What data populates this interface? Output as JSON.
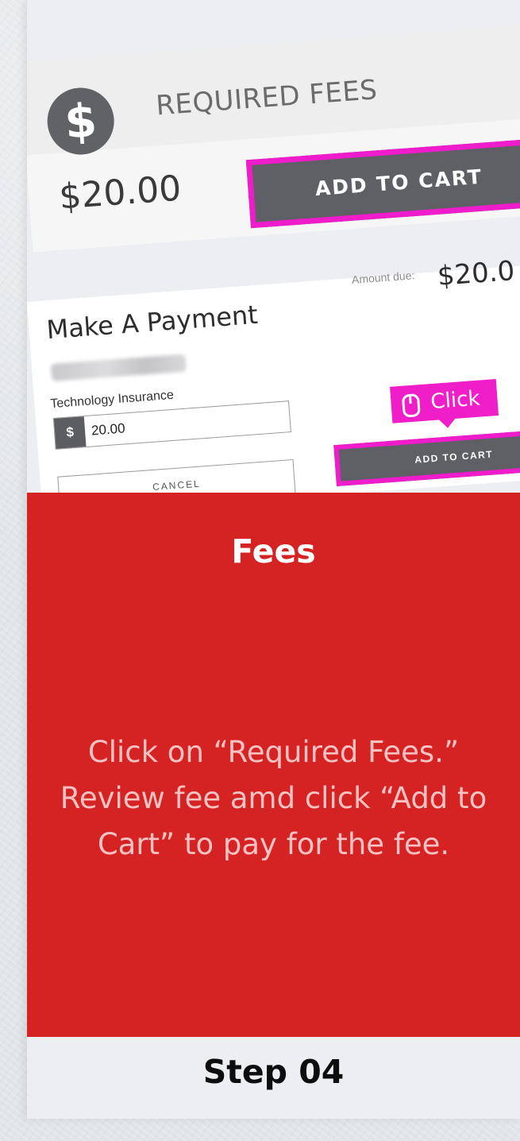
{
  "fees_screen": {
    "title": "REQUIRED FEES",
    "price": "$20.00",
    "add_to_cart": "ADD TO CART",
    "dollar_symbol": "$"
  },
  "payment_screen": {
    "title": "Make A Payment",
    "amount_due_label": "Amount due:",
    "amount_due_value": "$20.0",
    "field_label": "Technology Insurance",
    "currency_symbol": "$",
    "amount_value": "20.00",
    "cancel": "CANCEL",
    "click_hint": "Click",
    "add_to_cart": "ADD TO CART"
  },
  "panel": {
    "title": "Fees",
    "description": "Click on “Required Fees.” Review fee amd click “Add to Cart” to pay for the fee."
  },
  "footer": {
    "step": "Step 04"
  },
  "colors": {
    "panel_red": "#d52222",
    "highlight_magenta": "#ee1ccb",
    "button_gray": "#5f6065"
  },
  "icons": {
    "fee_badge": "dollar-icon",
    "click_pointer": "mouse-icon"
  }
}
